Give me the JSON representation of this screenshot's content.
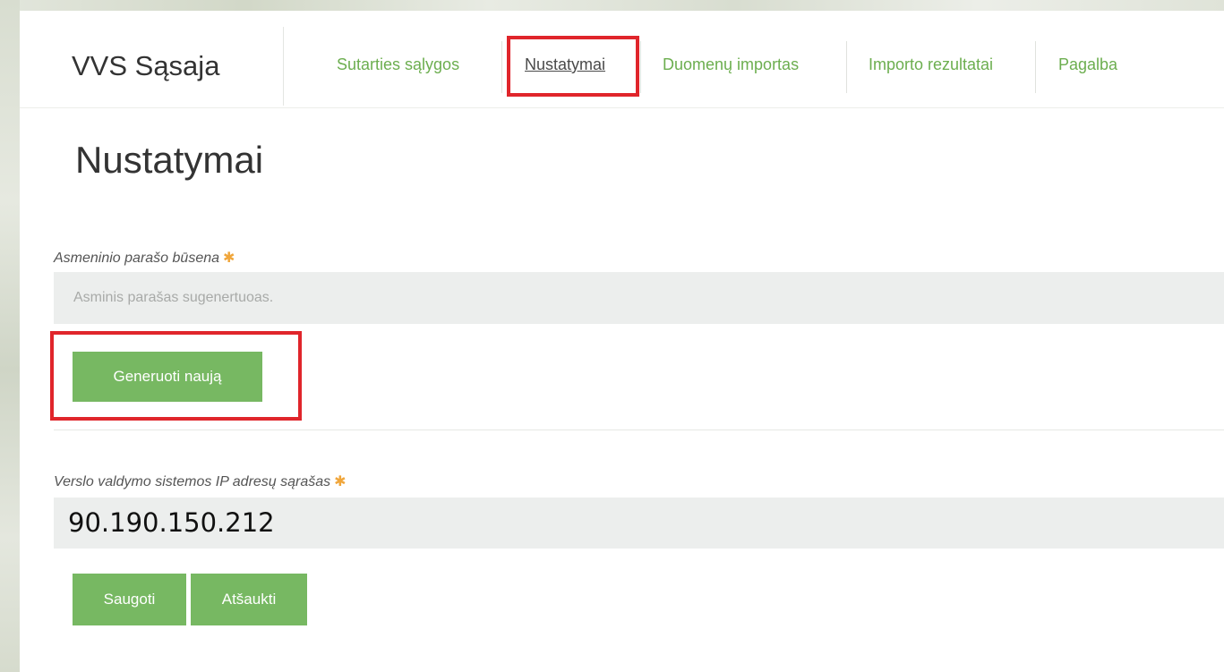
{
  "header": {
    "brand": "VVS Sąsaja",
    "nav": [
      {
        "label": "Sutarties sąlygos",
        "active": false
      },
      {
        "label": "Nustatymai",
        "active": true
      },
      {
        "label": "Duomenų importas",
        "active": false
      },
      {
        "label": "Importo rezultatai",
        "active": false
      },
      {
        "label": "Pagalba",
        "active": false
      }
    ]
  },
  "main": {
    "title": "Nustatymai",
    "signature": {
      "label": "Asmeninio parašo būsena",
      "required_mark": "✱",
      "status_text": "Asminis parašas sugenertuoas.",
      "generate_button": "Generuoti naują"
    },
    "ip_list": {
      "label": "Verslo valdymo sistemos IP adresų sąrašas",
      "required_mark": "✱",
      "value": "90.190.150.212"
    },
    "actions": {
      "save_button": "Saugoti",
      "cancel_button": "Atšaukti"
    }
  },
  "colors": {
    "accent_green": "#77b862",
    "nav_green": "#6cae4f",
    "highlight_red": "#e0252b",
    "required_star": "#f0a63b"
  }
}
